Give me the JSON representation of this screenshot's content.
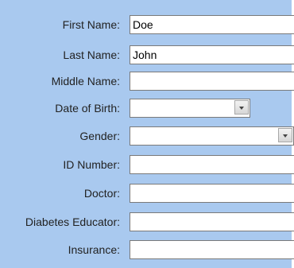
{
  "form": {
    "fields": [
      {
        "label": "First Name:",
        "value": "Doe"
      },
      {
        "label": "Last Name:",
        "value": "John"
      },
      {
        "label": "Middle Name:",
        "value": ""
      },
      {
        "label": "Date of Birth:",
        "value": ""
      },
      {
        "label": "Gender:",
        "value": ""
      },
      {
        "label": "ID Number:",
        "value": ""
      },
      {
        "label": "Doctor:",
        "value": ""
      },
      {
        "label": "Diabetes Educator:",
        "value": ""
      },
      {
        "label": "Insurance:",
        "value": ""
      }
    ]
  },
  "icons": {
    "dropdown": "chevron-down-icon"
  },
  "colors": {
    "panel_background": "#a9c9ef",
    "field_border": "#7a7a7a"
  }
}
